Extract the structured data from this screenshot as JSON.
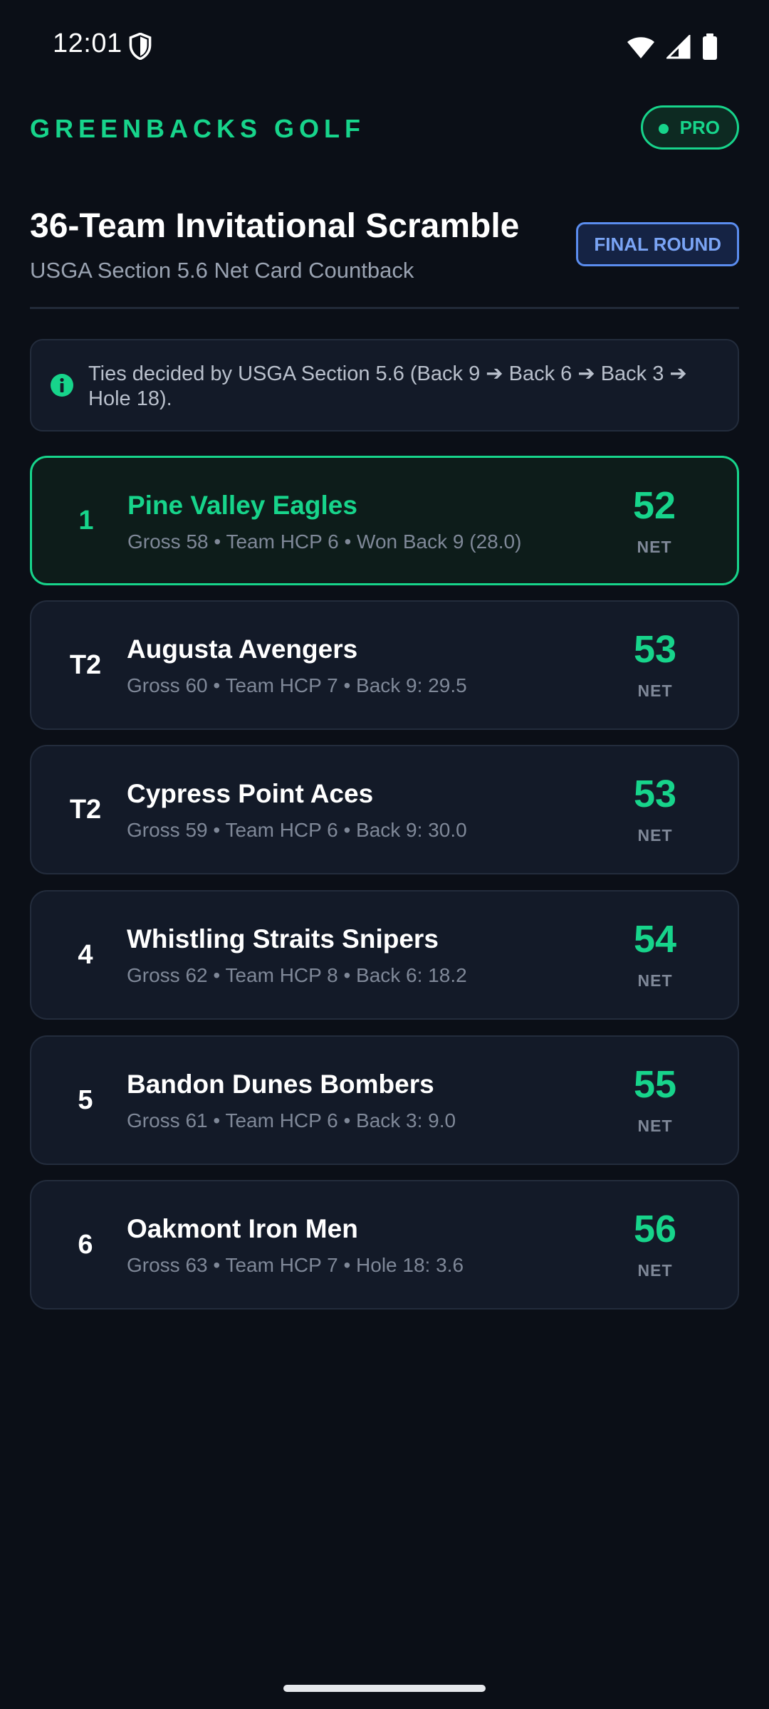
{
  "status_bar": {
    "time": "12:01",
    "icons": [
      "shield-icon",
      "wifi-icon",
      "signal-icon",
      "battery-icon"
    ]
  },
  "app_bar": {
    "brand": "GREENBACKS GOLF",
    "pro_badge": "PRO"
  },
  "header": {
    "title": "36-Team Invitational Scramble",
    "subtitle": "USGA Section 5.6 Net Card Countback",
    "round_badge": "FINAL ROUND"
  },
  "info": {
    "icon": "info-icon",
    "text": "Ties decided by USGA Section 5.6 (Back 9 ➔ Back 6 ➔ Back 3 ➔ Hole 18)."
  },
  "leaderboard": {
    "net_label": "NET",
    "rows": [
      {
        "rank": "1",
        "team": "Pine Valley Eagles",
        "detail": "Gross 58 • Team HCP 6 • Won Back 9 (28.0)",
        "net": "52",
        "leader": true
      },
      {
        "rank": "T2",
        "team": "Augusta Avengers",
        "detail": "Gross 60 • Team HCP 7 • Back 9: 29.5",
        "net": "53",
        "leader": false
      },
      {
        "rank": "T2",
        "team": "Cypress Point Aces",
        "detail": "Gross 59 • Team HCP 6 • Back 9: 30.0",
        "net": "53",
        "leader": false
      },
      {
        "rank": "4",
        "team": "Whistling Straits Snipers",
        "detail": "Gross 62 • Team HCP 8 • Back 6: 18.2",
        "net": "54",
        "leader": false
      },
      {
        "rank": "5",
        "team": "Bandon Dunes Bombers",
        "detail": "Gross 61 • Team HCP 6 • Back 3: 9.0",
        "net": "55",
        "leader": false
      },
      {
        "rank": "6",
        "team": "Oakmont Iron Men",
        "detail": "Gross 63 • Team HCP 7 • Hole 18: 3.6",
        "net": "56",
        "leader": false
      }
    ]
  },
  "colors": {
    "background": "#0b0f17",
    "accent_green": "#17d48b",
    "accent_blue": "#5b8def",
    "card": "#131a28"
  }
}
